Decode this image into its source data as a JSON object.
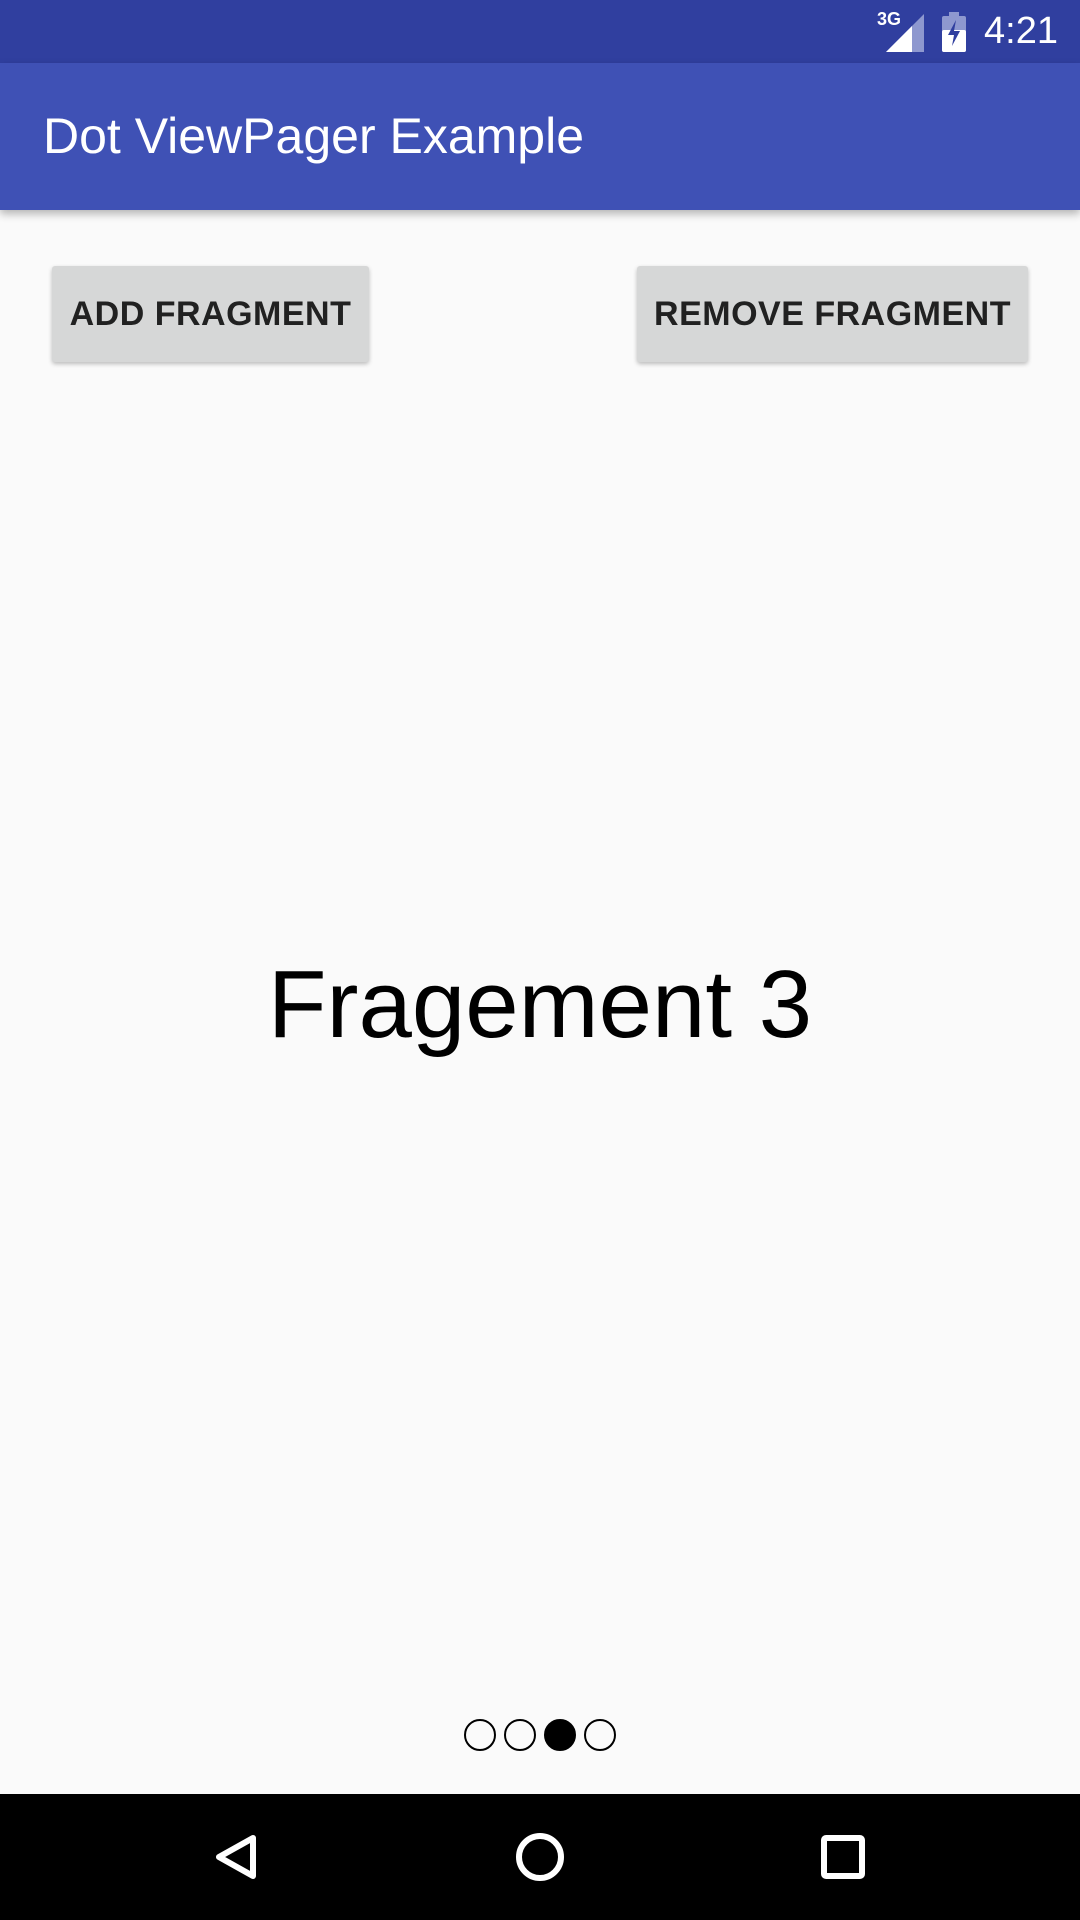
{
  "status_bar": {
    "network_type": "3G",
    "clock": "4:21",
    "icons": [
      "signal-icon",
      "battery-charging-icon"
    ]
  },
  "app_bar": {
    "title": "Dot ViewPager Example"
  },
  "actions": {
    "add_label": "ADD FRAGMENT",
    "remove_label": "REMOVE FRAGMENT"
  },
  "pager": {
    "current_page_label": "Fragement 3",
    "page_count": 4,
    "active_index": 2
  },
  "nav_bar": {
    "icons": [
      "back-icon",
      "home-icon",
      "recents-icon"
    ]
  },
  "colors": {
    "status_bar": "#303f9f",
    "app_bar": "#3f51b5",
    "button_bg": "#d6d7d7",
    "background": "#fafafa"
  }
}
